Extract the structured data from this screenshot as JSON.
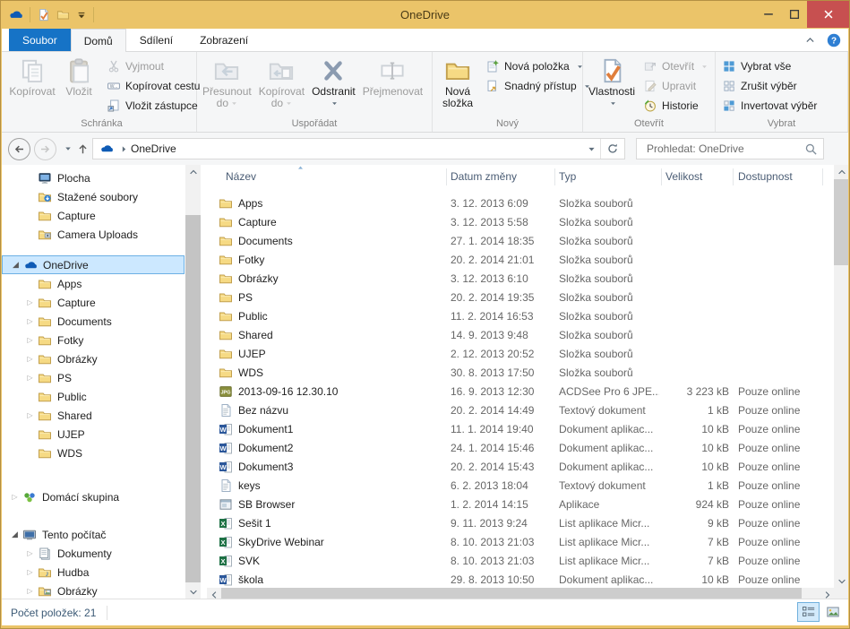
{
  "colors": {
    "frame": "#ebc469",
    "close_red": "#c75050",
    "file_tab_blue": "#1673c6",
    "selection_bg": "#cce8ff",
    "selection_border": "#6db1e4",
    "onedrive_blue": "#0f5bb5",
    "folder_yellow": "#f6da84"
  },
  "window": {
    "title": "OneDrive"
  },
  "tabs": {
    "file_label": "Soubor",
    "active": "Domů",
    "items": [
      "Domů",
      "Sdílení",
      "Zobrazení"
    ]
  },
  "ribbon": {
    "groups": [
      {
        "label": "Schránka",
        "min_width": 212,
        "buttons": [
          {
            "label": "Kopírovat",
            "size": "big",
            "icon": "copy",
            "enabled": false
          },
          {
            "label": "Vložit",
            "size": "big",
            "icon": "paste",
            "enabled": false
          },
          {
            "label": "Vyjmout",
            "size": "small",
            "icon": "cut",
            "enabled": false
          },
          {
            "label": "Kopírovat cestu",
            "size": "small",
            "icon": "copy-path",
            "enabled": true
          },
          {
            "label": "Vložit zástupce",
            "size": "small",
            "icon": "paste-shortcut",
            "enabled": true
          }
        ]
      },
      {
        "label": "Uspořádat",
        "min_width": 263,
        "buttons": [
          {
            "label": "Přesunout",
            "label2": "do",
            "size": "big",
            "icon": "move-to",
            "enabled": false,
            "has_menu": true
          },
          {
            "label": "Kopírovat",
            "label2": "do",
            "size": "big",
            "icon": "copy-to",
            "enabled": false,
            "has_menu": true
          },
          {
            "label": "Odstranit",
            "label2": "",
            "size": "big",
            "icon": "delete",
            "enabled": true,
            "has_menu": true
          },
          {
            "label": "Přejmenovat",
            "size": "big",
            "icon": "rename",
            "enabled": false
          }
        ]
      },
      {
        "label": "Nový",
        "min_width": 151,
        "buttons": [
          {
            "label": "Nová",
            "label2": "složka",
            "size": "big",
            "icon": "new-folder",
            "enabled": true
          },
          {
            "label": "Nová položka",
            "size": "small",
            "icon": "new-item",
            "enabled": true,
            "has_menu": true
          },
          {
            "label": "Snadný přístup",
            "size": "small",
            "icon": "easy-access",
            "enabled": true,
            "has_menu": true
          }
        ]
      },
      {
        "label": "Otevřít",
        "min_width": 148,
        "buttons": [
          {
            "label": "Vlastnosti",
            "label2": "",
            "size": "big",
            "icon": "properties",
            "enabled": true,
            "has_menu": true
          },
          {
            "label": "Otevřít",
            "size": "small",
            "icon": "open",
            "enabled": false,
            "has_menu": true
          },
          {
            "label": "Upravit",
            "size": "small",
            "icon": "edit",
            "enabled": false
          },
          {
            "label": "Historie",
            "size": "small",
            "icon": "history",
            "enabled": true
          }
        ]
      },
      {
        "label": "Vybrat",
        "min_width": 148,
        "buttons": [
          {
            "label": "Vybrat vše",
            "size": "small",
            "icon": "select-all",
            "enabled": true
          },
          {
            "label": "Zrušit výběr",
            "size": "small",
            "icon": "select-none",
            "enabled": true
          },
          {
            "label": "Invertovat výběr",
            "size": "small",
            "icon": "invert-selection",
            "enabled": true
          }
        ]
      }
    ]
  },
  "addressbar": {
    "path_root": "OneDrive",
    "search_placeholder": "Prohledat: OneDrive"
  },
  "sidebar": {
    "items": [
      {
        "label": "Plocha",
        "icon": "desktop",
        "indent": 1
      },
      {
        "label": "Stažené soubory",
        "icon": "downloads",
        "indent": 1
      },
      {
        "label": "Capture",
        "icon": "folder",
        "indent": 1
      },
      {
        "label": "Camera Uploads",
        "icon": "folder-camera",
        "indent": 1
      },
      {
        "gap": 13
      },
      {
        "label": "OneDrive",
        "icon": "onedrive-cloud",
        "indent": 0,
        "expander": "expanded",
        "selected": true
      },
      {
        "label": "Apps",
        "icon": "folder",
        "indent": 1
      },
      {
        "label": "Capture",
        "icon": "folder",
        "indent": 1,
        "expander": "collapsed"
      },
      {
        "label": "Documents",
        "icon": "folder",
        "indent": 1,
        "expander": "collapsed"
      },
      {
        "label": "Fotky",
        "icon": "folder",
        "indent": 1,
        "expander": "collapsed"
      },
      {
        "label": "Obrázky",
        "icon": "folder",
        "indent": 1,
        "expander": "collapsed"
      },
      {
        "label": "PS",
        "icon": "folder",
        "indent": 1,
        "expander": "collapsed"
      },
      {
        "label": "Public",
        "icon": "folder",
        "indent": 1
      },
      {
        "label": "Shared",
        "icon": "folder",
        "indent": 1,
        "expander": "collapsed"
      },
      {
        "label": "UJEP",
        "icon": "folder",
        "indent": 1
      },
      {
        "label": "WDS",
        "icon": "folder",
        "indent": 1
      },
      {
        "gap": 28
      },
      {
        "label": "Domácí skupina",
        "icon": "homegroup",
        "indent": 0,
        "expander": "collapsed"
      },
      {
        "gap": 21
      },
      {
        "label": "Tento počítač",
        "icon": "computer",
        "indent": 0,
        "expander": "expanded"
      },
      {
        "label": "Dokumenty",
        "icon": "documents-library",
        "indent": 1,
        "expander": "collapsed"
      },
      {
        "label": "Hudba",
        "icon": "music-library",
        "indent": 1,
        "expander": "collapsed"
      },
      {
        "label": "Obrázky",
        "icon": "pictures-library",
        "indent": 1,
        "expander": "collapsed"
      }
    ]
  },
  "filelist": {
    "columns": [
      "Název",
      "Datum změny",
      "Typ",
      "Velikost",
      "Dostupnost"
    ],
    "sort": {
      "column": "Název",
      "direction": "asc"
    },
    "rows": [
      {
        "name": "Apps",
        "icon": "folder",
        "date": "3. 12. 2013 6:09",
        "type": "Složka souborů",
        "size": "",
        "availability": ""
      },
      {
        "name": "Capture",
        "icon": "folder",
        "date": "3. 12. 2013 5:58",
        "type": "Složka souborů",
        "size": "",
        "availability": ""
      },
      {
        "name": "Documents",
        "icon": "folder",
        "date": "27. 1. 2014 18:35",
        "type": "Složka souborů",
        "size": "",
        "availability": ""
      },
      {
        "name": "Fotky",
        "icon": "folder",
        "date": "20. 2. 2014 21:01",
        "type": "Složka souborů",
        "size": "",
        "availability": ""
      },
      {
        "name": "Obrázky",
        "icon": "folder",
        "date": "3. 12. 2013 6:10",
        "type": "Složka souborů",
        "size": "",
        "availability": ""
      },
      {
        "name": "PS",
        "icon": "folder",
        "date": "20. 2. 2014 19:35",
        "type": "Složka souborů",
        "size": "",
        "availability": ""
      },
      {
        "name": "Public",
        "icon": "folder",
        "date": "11. 2. 2014 16:53",
        "type": "Složka souborů",
        "size": "",
        "availability": ""
      },
      {
        "name": "Shared",
        "icon": "folder",
        "date": "14. 9. 2013 9:48",
        "type": "Složka souborů",
        "size": "",
        "availability": ""
      },
      {
        "name": "UJEP",
        "icon": "folder",
        "date": "2. 12. 2013 20:52",
        "type": "Složka souborů",
        "size": "",
        "availability": ""
      },
      {
        "name": "WDS",
        "icon": "folder",
        "date": "30. 8. 2013 17:50",
        "type": "Složka souborů",
        "size": "",
        "availability": ""
      },
      {
        "name": "2013-09-16 12.30.10",
        "icon": "jpg",
        "date": "16. 9. 2013 12:30",
        "type": "ACDSee Pro 6 JPE...",
        "size": "3 223 kB",
        "availability": "Pouze online"
      },
      {
        "name": "Bez názvu",
        "icon": "text-doc",
        "date": "20. 2. 2014 14:49",
        "type": "Textový dokument",
        "size": "1 kB",
        "availability": "Pouze online"
      },
      {
        "name": "Dokument1",
        "icon": "word",
        "date": "11. 1. 2014 19:40",
        "type": "Dokument aplikac...",
        "size": "10 kB",
        "availability": "Pouze online"
      },
      {
        "name": "Dokument2",
        "icon": "word",
        "date": "24. 1. 2014 15:46",
        "type": "Dokument aplikac...",
        "size": "10 kB",
        "availability": "Pouze online"
      },
      {
        "name": "Dokument3",
        "icon": "word",
        "date": "20. 2. 2014 15:43",
        "type": "Dokument aplikac...",
        "size": "10 kB",
        "availability": "Pouze online"
      },
      {
        "name": "keys",
        "icon": "text-doc",
        "date": "6. 2. 2013 18:04",
        "type": "Textový dokument",
        "size": "1 kB",
        "availability": "Pouze online"
      },
      {
        "name": "SB Browser",
        "icon": "app",
        "date": "1. 2. 2014 14:15",
        "type": "Aplikace",
        "size": "924 kB",
        "availability": "Pouze online"
      },
      {
        "name": "Sešit 1",
        "icon": "excel",
        "date": "9. 11. 2013 9:24",
        "type": "List aplikace Micr...",
        "size": "9 kB",
        "availability": "Pouze online"
      },
      {
        "name": "SkyDrive Webinar",
        "icon": "excel",
        "date": "8. 10. 2013 21:03",
        "type": "List aplikace Micr...",
        "size": "7 kB",
        "availability": "Pouze online"
      },
      {
        "name": "SVK",
        "icon": "excel",
        "date": "8. 10. 2013 21:03",
        "type": "List aplikace Micr...",
        "size": "7 kB",
        "availability": "Pouze online"
      },
      {
        "name": "škola",
        "icon": "word",
        "date": "29. 8. 2013 10:50",
        "type": "Dokument aplikac...",
        "size": "10 kB",
        "availability": "Pouze online"
      }
    ]
  },
  "statusbar": {
    "items_count": "Počet položek: 21"
  }
}
